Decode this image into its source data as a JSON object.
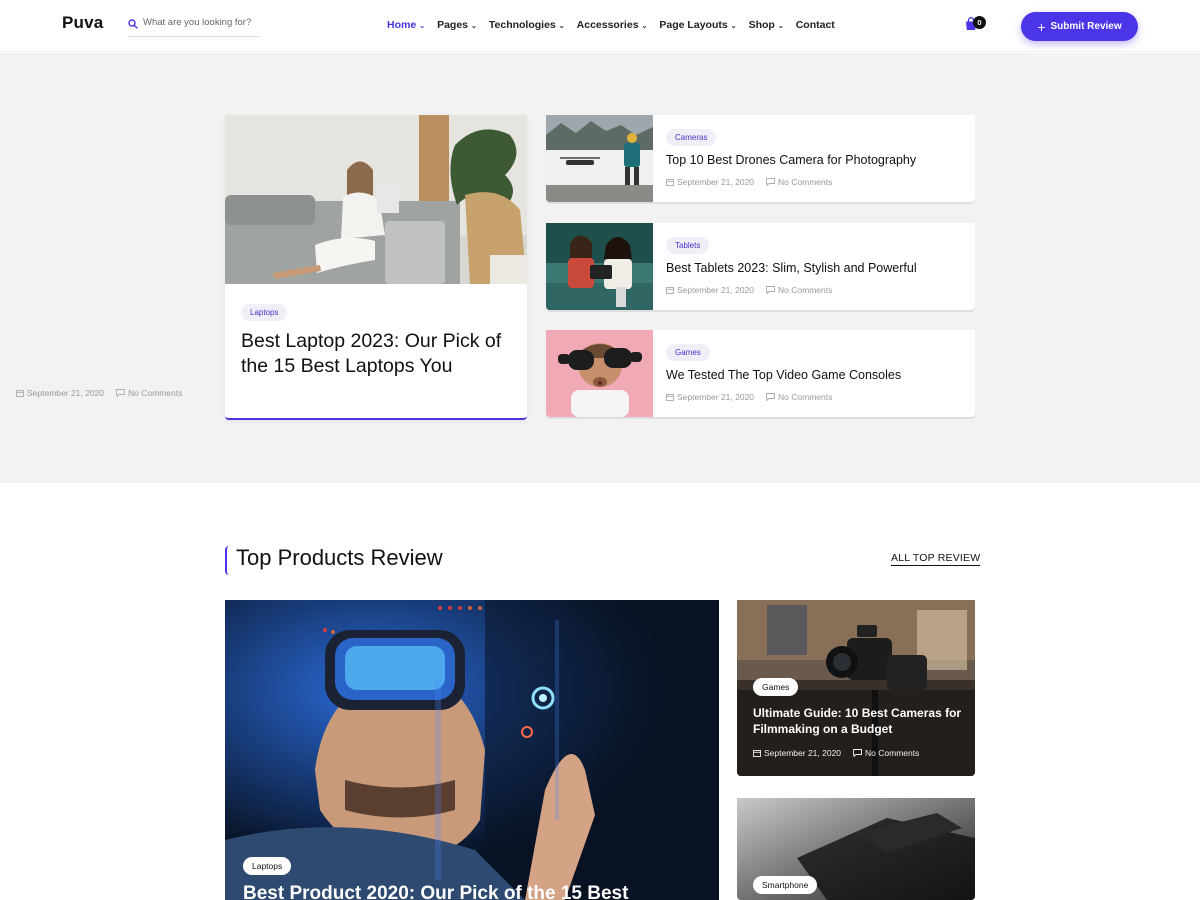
{
  "header": {
    "logo": "Puva",
    "search_placeholder": "What are you looking for?",
    "nav": [
      {
        "label": "Home",
        "active": true,
        "has_dropdown": true
      },
      {
        "label": "Pages",
        "active": false,
        "has_dropdown": true
      },
      {
        "label": "Technologies",
        "active": false,
        "has_dropdown": true
      },
      {
        "label": "Accessories",
        "active": false,
        "has_dropdown": true
      },
      {
        "label": "Page Layouts",
        "active": false,
        "has_dropdown": true
      },
      {
        "label": "Shop",
        "active": false,
        "has_dropdown": true
      },
      {
        "label": "Contact",
        "active": false,
        "has_dropdown": false
      }
    ],
    "cart_count": "0",
    "submit_label": "Submit Review"
  },
  "hero": {
    "featured": {
      "tag": "Laptops",
      "title": "Best Laptop 2023: Our Pick of the 15 Best Laptops You",
      "date": "September 21, 2020",
      "comments": "No Comments"
    },
    "side_posts": [
      {
        "tag": "Cameras",
        "title": "Top 10 Best Drones Camera for Photography",
        "date": "September 21, 2020",
        "comments": "No Comments"
      },
      {
        "tag": "Tablets",
        "title": "Best Tablets 2023: Slim, Stylish and Powerful",
        "date": "September 21, 2020",
        "comments": "No Comments"
      },
      {
        "tag": "Games",
        "title": "We Tested The Top Video Game Consoles",
        "date": "September 21, 2020",
        "comments": "No Comments"
      }
    ]
  },
  "top_products": {
    "title": "Top Products Review",
    "link": "ALL TOP REVIEW",
    "big": {
      "tag": "Laptops",
      "title": "Best Product 2020: Our Pick of the 15 Best"
    },
    "small": [
      {
        "tag": "Games",
        "title": "Ultimate Guide: 10 Best Cameras for Filmmaking on a Budget",
        "date": "September 21, 2020",
        "comments": "No Comments"
      },
      {
        "tag": "Smartphone"
      }
    ]
  },
  "colors": {
    "accent": "#4a35e8",
    "hero_bg": "#f2f2f2",
    "tag_bg": "#f0eff7"
  }
}
